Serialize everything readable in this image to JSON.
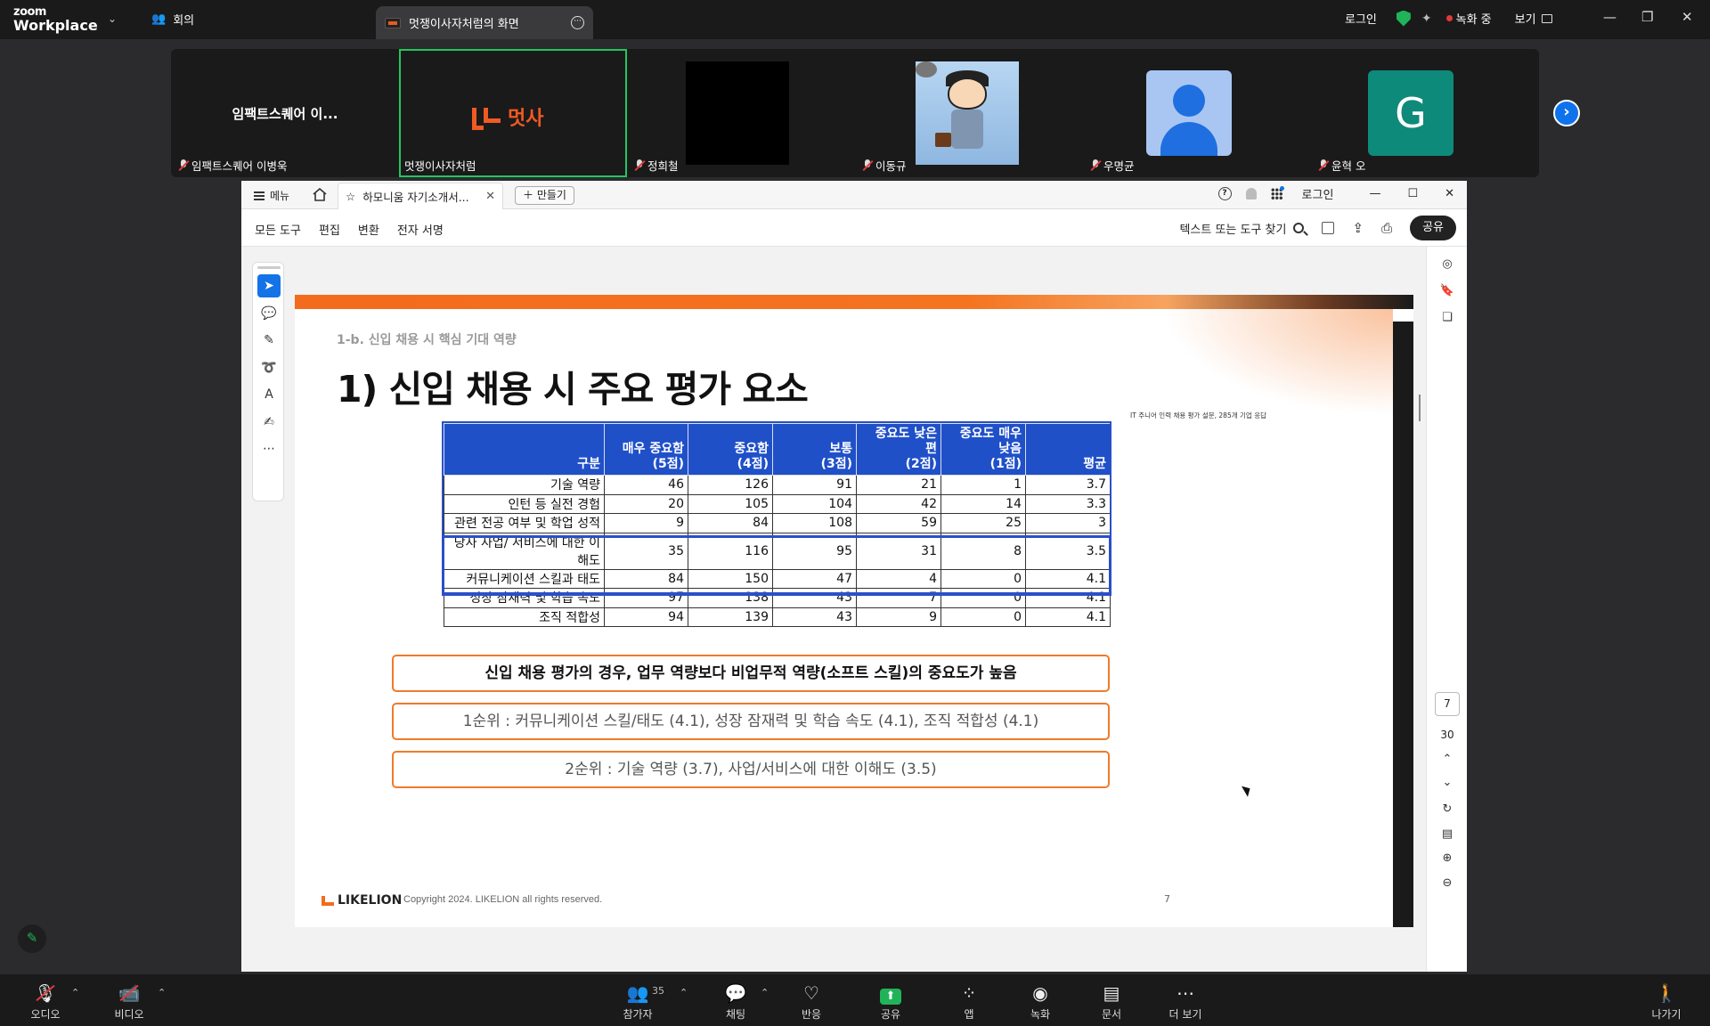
{
  "zoom": {
    "logo_line1": "zoom",
    "logo_line2": "Workplace",
    "meeting_label": "회의",
    "share_tab_title": "멋쟁이사자처럼의 화면",
    "login": "로그인",
    "recording": "녹화 중",
    "view": "보기"
  },
  "participants": [
    {
      "display": "임팩트스퀘어 이...",
      "name": "임팩트스퀘어 이병욱"
    },
    {
      "display": "멋사",
      "name": "멋쟁이사자처럼"
    },
    {
      "name": "정희철"
    },
    {
      "name": "이동규"
    },
    {
      "name": "우명균"
    },
    {
      "avatar_letter": "G",
      "name": "윤혁 오"
    }
  ],
  "app": {
    "menu": "메뉴",
    "tab_title": "하모니움 자기소개서...",
    "create": "만들기",
    "login": "로그인",
    "toolbar": [
      "모든 도구",
      "편집",
      "변환",
      "전자 서명"
    ],
    "search_label": "텍스트 또는 도구 찾기",
    "share": "공유",
    "page_current": "7",
    "page_total": "30"
  },
  "slide": {
    "subheading": "1-b. 신입 채용 시 핵심 기대 역량",
    "title": "1) 신입 채용 시 주요 평가 요소",
    "source_note": "IT 주니어 인력 채용 평가 설문, 285개 기업 응답",
    "table": {
      "headers": [
        "구분",
        "매우 중요함\n(5점)",
        "중요함\n(4점)",
        "보통\n(3점)",
        "중요도 낮은 편\n(2점)",
        "중요도 매우 낮음\n(1점)",
        "평균"
      ],
      "rows": [
        [
          "기술 역량",
          "46",
          "126",
          "91",
          "21",
          "1",
          "3.7"
        ],
        [
          "인턴 등 실전 경험",
          "20",
          "105",
          "104",
          "42",
          "14",
          "3.3"
        ],
        [
          "관련 전공 여부 및 학업 성적",
          "9",
          "84",
          "108",
          "59",
          "25",
          "3"
        ],
        [
          "당사 사업/ 서비스에 대한 이해도",
          "35",
          "116",
          "95",
          "31",
          "8",
          "3.5"
        ],
        [
          "커뮤니케이션 스킬과 태도",
          "84",
          "150",
          "47",
          "4",
          "0",
          "4.1"
        ],
        [
          "성장 잠재력 및 학습 속도",
          "97",
          "138",
          "43",
          "7",
          "0",
          "4.1"
        ],
        [
          "조직 적합성",
          "94",
          "139",
          "43",
          "9",
          "0",
          "4.1"
        ]
      ]
    },
    "callout_main": "신입 채용 평가의 경우, 업무 역량보다 비업무적 역량(소프트 스킬)의 중요도가 높음",
    "callout_rank1": "1순위 : 커뮤니케이션 스킬/태도 (4.1), 성장 잠재력 및 학습 속도 (4.1), 조직 적합성 (4.1)",
    "callout_rank2": "2순위 : 기술 역량 (3.7), 사업/서비스에 대한 이해도 (3.5)",
    "footer_logo": "LIKELION",
    "copyright": "Copyright 2024. LIKELION all rights reserved.",
    "page_number": "7"
  },
  "controls": {
    "audio": "오디오",
    "video": "비디오",
    "participants": "참가자",
    "participant_count": "35",
    "chat": "채팅",
    "reactions": "반응",
    "share": "공유",
    "apps": "앱",
    "record": "녹화",
    "docs": "문서",
    "more": "더 보기",
    "leave": "나가기"
  },
  "colors": {
    "zoom_bg": "#1a1a1a",
    "active_speaker": "#24c65d",
    "slide_accent": "#f36b1c",
    "table_header": "#2050c8"
  }
}
